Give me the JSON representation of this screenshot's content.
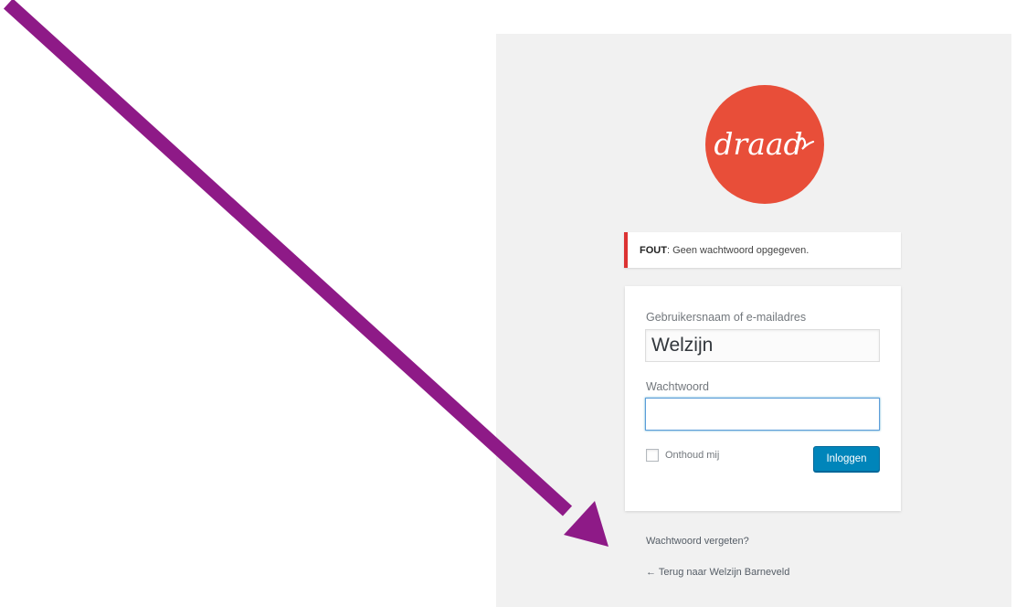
{
  "logo": {
    "text": "draad",
    "background_color": "#e84e39",
    "text_color": "#ffffff"
  },
  "error": {
    "prefix": "FOUT",
    "message": ": Geen wachtwoord opgegeven.",
    "accent_color": "#dc3232"
  },
  "form": {
    "username_label": "Gebruikersnaam of e-mailadres",
    "username_value": "Welzijn",
    "password_label": "Wachtwoord",
    "password_value": "",
    "remember_label": "Onthoud mij",
    "remember_checked": false,
    "submit_label": "Inloggen",
    "button_color": "#0085ba"
  },
  "links": {
    "lost_password": "Wachtwoord vergeten?",
    "back_to_site": "← Terug naar Welzijn Barneveld"
  },
  "annotation": {
    "arrow_color": "#8e1a87"
  },
  "colors": {
    "panel_background": "#f1f1f1"
  }
}
